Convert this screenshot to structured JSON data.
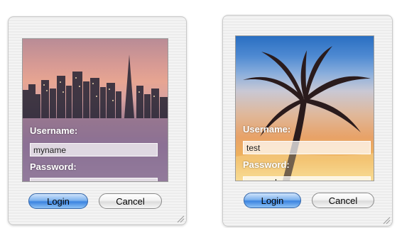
{
  "dialogs": [
    {
      "background": "city-skyline",
      "username_label": "Username:",
      "username_value": "myname",
      "password_label": "Password:",
      "password_value": "********",
      "login_label": "Login",
      "cancel_label": "Cancel"
    },
    {
      "background": "palm-sunset",
      "username_label": "Username:",
      "username_value": "test",
      "password_label": "Password:",
      "password_value": "*********",
      "login_label": "Login",
      "cancel_label": "Cancel"
    }
  ],
  "colors": {
    "default_button": "#4a8fe6",
    "label_text": "#ffffff"
  },
  "icons": [
    "resize-grip-icon"
  ]
}
